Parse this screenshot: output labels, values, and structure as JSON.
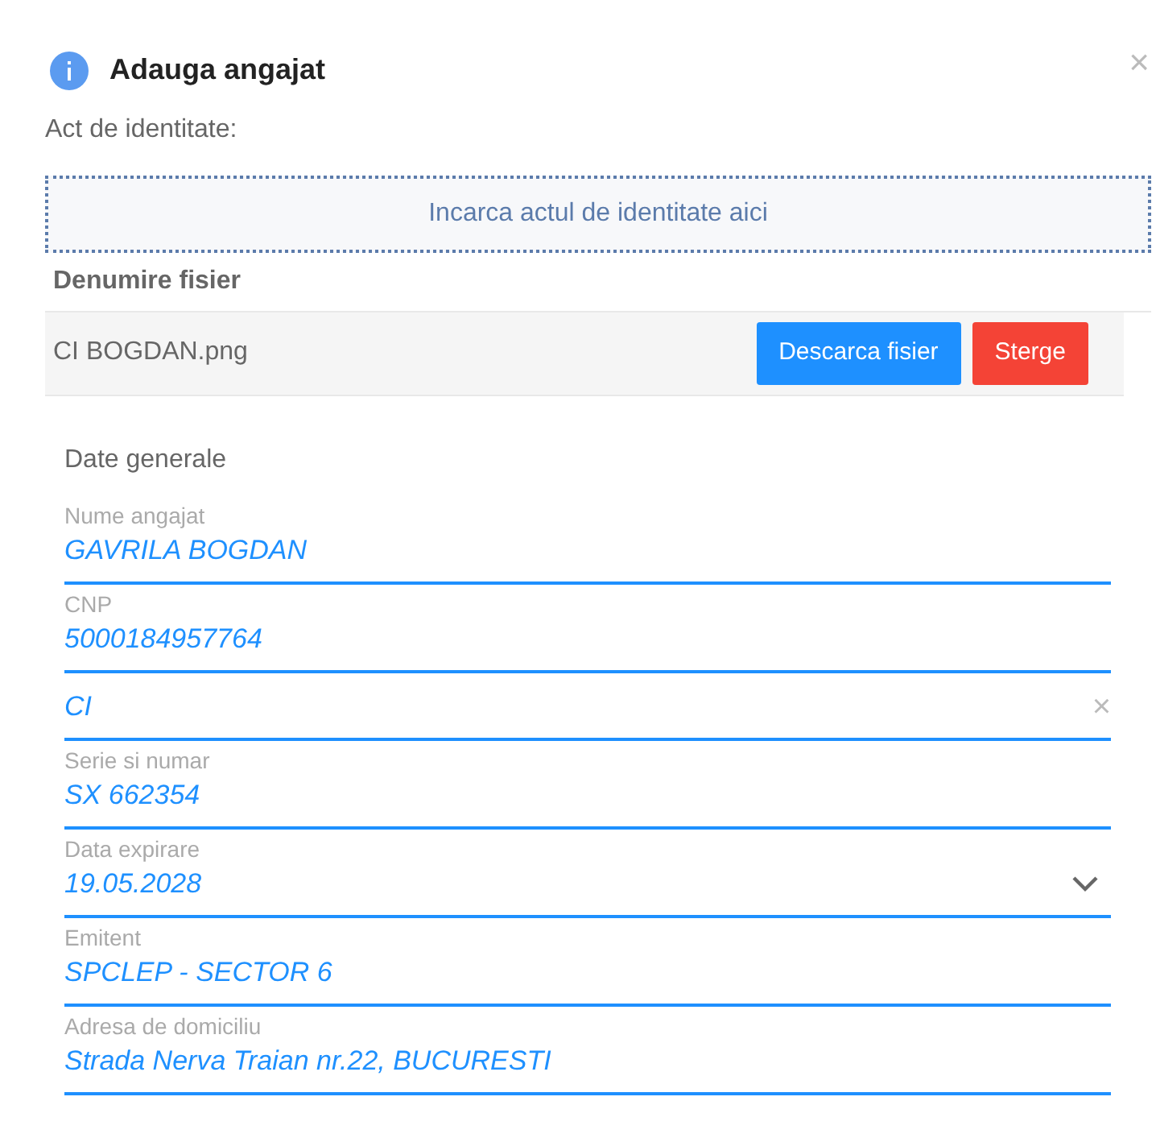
{
  "dialog": {
    "title": "Adauga angajat",
    "close": "×"
  },
  "document_label": "Act de identitate:",
  "dropzone": "Incarca actul de identitate aici",
  "files": {
    "columns": [
      "Denumire fisier"
    ],
    "rows": [
      {
        "name": "CI BOGDAN.png",
        "actions": [
          {
            "label": "Descarca fisier",
            "kind": "download"
          },
          {
            "label": "Sterge",
            "kind": "delete"
          }
        ]
      }
    ]
  },
  "section_title": "Date generale",
  "fields": [
    {
      "kind": "text",
      "label": "Nume angajat",
      "value": "GAVRILA BOGDAN"
    },
    {
      "kind": "text",
      "label": "CNP",
      "value": "5000184957764"
    },
    {
      "kind": "clearable",
      "value": "CI",
      "clear": "×"
    },
    {
      "kind": "text",
      "label": "Serie si numar",
      "value": "SX 662354"
    },
    {
      "kind": "date",
      "label": "Data expirare",
      "value": "19.05.2028"
    },
    {
      "kind": "text",
      "label": "Emitent",
      "value": "SPCLEP - SECTOR 6"
    },
    {
      "kind": "text",
      "label": "Adresa de domiciliu",
      "value": "Strada Nerva Traian nr.22, BUCURESTI"
    }
  ]
}
